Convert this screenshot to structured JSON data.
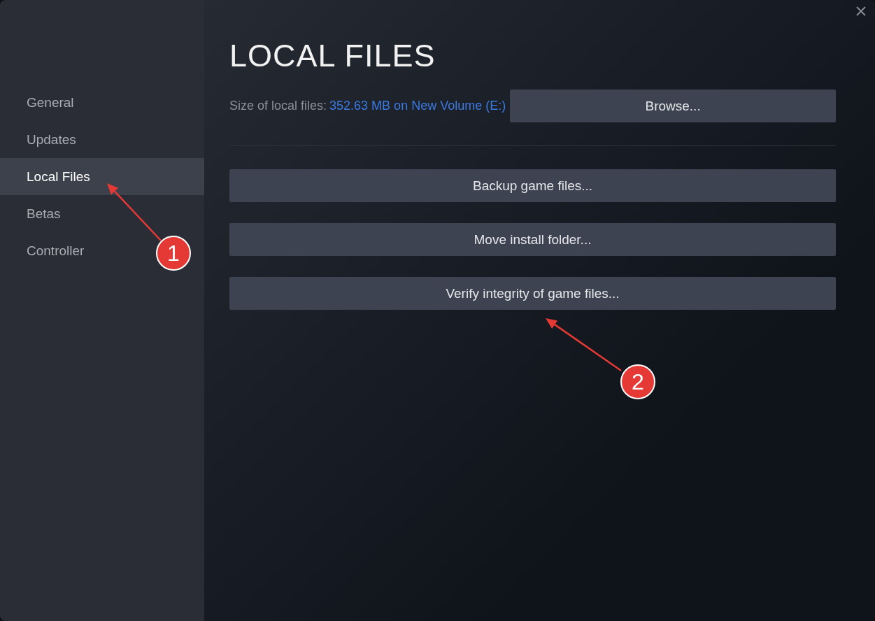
{
  "sidebar": {
    "items": [
      {
        "label": "General",
        "selected": false
      },
      {
        "label": "Updates",
        "selected": false
      },
      {
        "label": "Local Files",
        "selected": true
      },
      {
        "label": "Betas",
        "selected": false
      },
      {
        "label": "Controller",
        "selected": false
      }
    ]
  },
  "panel": {
    "title": "LOCAL FILES",
    "size_label": "Size of local files:",
    "size_value": "352.63 MB on New Volume (E:)",
    "browse_button": "Browse...",
    "actions": [
      "Backup game files...",
      "Move install folder...",
      "Verify integrity of game files..."
    ]
  },
  "annotations": [
    {
      "label": "1"
    },
    {
      "label": "2"
    }
  ]
}
